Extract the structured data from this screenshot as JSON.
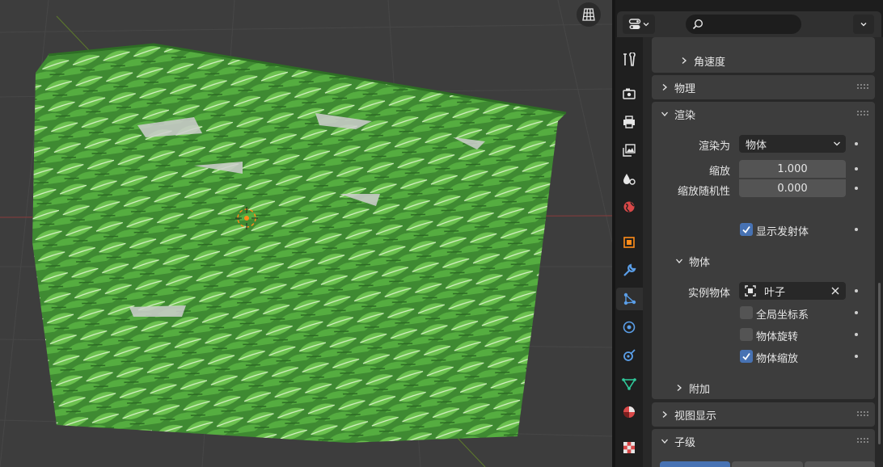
{
  "header": {
    "editor_type_icon": "properties-editor-icon",
    "search_placeholder": "",
    "search_icon": "search-icon"
  },
  "viewport": {
    "overlay_button_icon": "grid-view-icon"
  },
  "tabs": [
    {
      "name": "tool",
      "icon": "wrench-screwdriver-icon"
    },
    {
      "name": "render",
      "icon": "camera-back-icon"
    },
    {
      "name": "output",
      "icon": "printer-icon"
    },
    {
      "name": "view-layer",
      "icon": "image-stack-icon"
    },
    {
      "name": "scene",
      "icon": "scene-drops-icon"
    },
    {
      "name": "world",
      "icon": "globe-icon"
    },
    {
      "name": "object",
      "icon": "orange-cube-icon"
    },
    {
      "name": "modifiers",
      "icon": "wrench-icon"
    },
    {
      "name": "particles",
      "icon": "particles-icon",
      "active": true
    },
    {
      "name": "physics",
      "icon": "physics-orbit-icon"
    },
    {
      "name": "constraints",
      "icon": "constraint-icon"
    },
    {
      "name": "data",
      "icon": "mesh-data-icon"
    },
    {
      "name": "material",
      "icon": "material-sphere-icon"
    },
    {
      "name": "texture",
      "icon": "checker-texture-icon"
    }
  ],
  "panels": {
    "angular_velocity": "角速度",
    "physics": "物理",
    "render": {
      "title": "渲染",
      "render_as_label": "渲染为",
      "render_as_value": "物体",
      "scale_label": "缩放",
      "scale_value": "1.000",
      "scale_random_label": "缩放随机性",
      "scale_random_value": "0.000",
      "show_emitter_label": "显示发射体",
      "show_emitter_checked": true,
      "object_panel": {
        "title": "物体",
        "instance_object_label": "实例物体",
        "instance_object_value": "叶子",
        "global_coords_label": "全局坐标系",
        "global_coords_checked": false,
        "object_rotation_label": "物体旋转",
        "object_rotation_checked": false,
        "object_scale_label": "物体缩放",
        "object_scale_checked": true
      },
      "extra": "附加"
    },
    "viewport_display": "视图显示",
    "children": "子级"
  },
  "colors": {
    "accent": "#4772b3",
    "leaf_green": "#4a9a38",
    "origin_orange": "#ff8c1a"
  }
}
